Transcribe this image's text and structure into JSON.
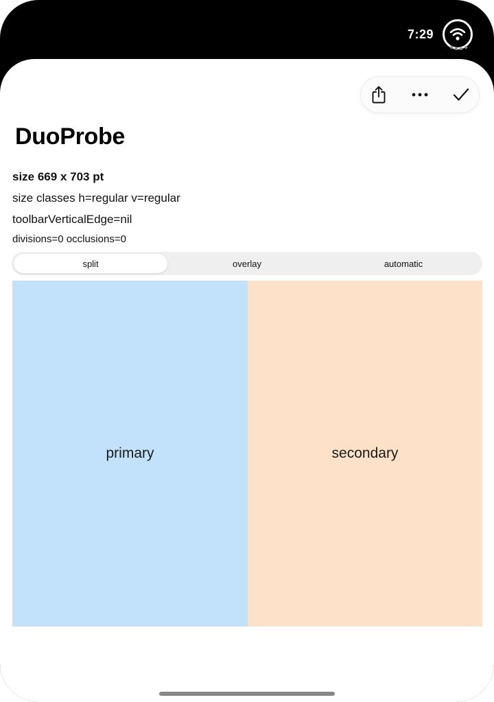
{
  "status": {
    "time": "7:29",
    "wifi_icon": "wifi-icon",
    "colors": {
      "bar": "#000000",
      "text": "#ffffff"
    }
  },
  "toolbar": {
    "buttons": [
      {
        "name": "share",
        "icon": "share-icon"
      },
      {
        "name": "more",
        "icon": "ellipsis-icon"
      },
      {
        "name": "done",
        "icon": "checkmark-icon"
      }
    ]
  },
  "app": {
    "title": "DuoProbe"
  },
  "info": {
    "size": "size 669 x 703 pt",
    "size_classes": "size classes h=regular v=regular",
    "toolbar_edge": "toolbarVerticalEdge=nil",
    "divisions": "divisions=0 occlusions=0"
  },
  "segmented": {
    "options": [
      "split",
      "overlay",
      "automatic"
    ],
    "selected": "split"
  },
  "panes": {
    "primary": {
      "label": "primary",
      "color": "#c2e1fb"
    },
    "secondary": {
      "label": "secondary",
      "color": "#fde2c9"
    }
  }
}
